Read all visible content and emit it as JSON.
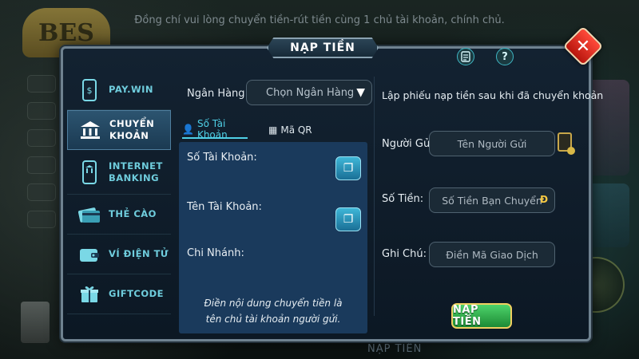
{
  "notice": "Đồng chí vui lòng chuyển tiền-rút tiền cùng 1 chủ tài khoản, chính chủ.",
  "background": {
    "bottom_text": "NẠP TIỀN"
  },
  "modal": {
    "title": "NẠP TIỀN",
    "close_symbol": "✕",
    "help_symbol": "?"
  },
  "sidebar": {
    "items": [
      {
        "label": "PAY.WIN",
        "icon": "phone-dollar-icon",
        "active": false
      },
      {
        "label": "CHUYỂN\nKHOẢN",
        "icon": "bank-icon",
        "active": true
      },
      {
        "label": "INTERNET\nBANKING",
        "icon": "mobile-banking-icon",
        "active": false
      },
      {
        "label": "THẺ CÀO",
        "icon": "card-icon",
        "active": false
      },
      {
        "label": "VÍ ĐIỆN TỬ",
        "icon": "wallet-icon",
        "active": false
      },
      {
        "label": "GIFTCODE",
        "icon": "gift-icon",
        "active": false
      }
    ]
  },
  "content": {
    "bank_label": "Ngân Hàng:",
    "bank_select": "Chọn Ngân Hàng",
    "tabs": {
      "account": "Số Tài Khoản",
      "qr": "Mã QR"
    },
    "account_number_label": "Số Tài Khoản:",
    "account_name_label": "Tên Tài Khoản:",
    "branch_label": "Chi Nhánh:",
    "note": "Điền nội dung chuyển tiền là tên chủ tài khoản người gửi."
  },
  "form": {
    "title": "Lập phiếu nạp tiền sau khi đã chuyển khoản",
    "sender_label": "Người Gửi:",
    "sender_placeholder": "Tên Người Gửi",
    "amount_label": "Số Tiền:",
    "amount_placeholder": "Số Tiền Bạn Chuyển",
    "currency": "Đ",
    "memo_label": "Ghi Chú:",
    "memo_placeholder": "Điền Mã Giao Dịch",
    "submit": "NẠP TIỀN"
  },
  "colors": {
    "accent": "#4fd0e6",
    "submit_green": "#2fb34d",
    "close_red": "#e02a1c"
  }
}
